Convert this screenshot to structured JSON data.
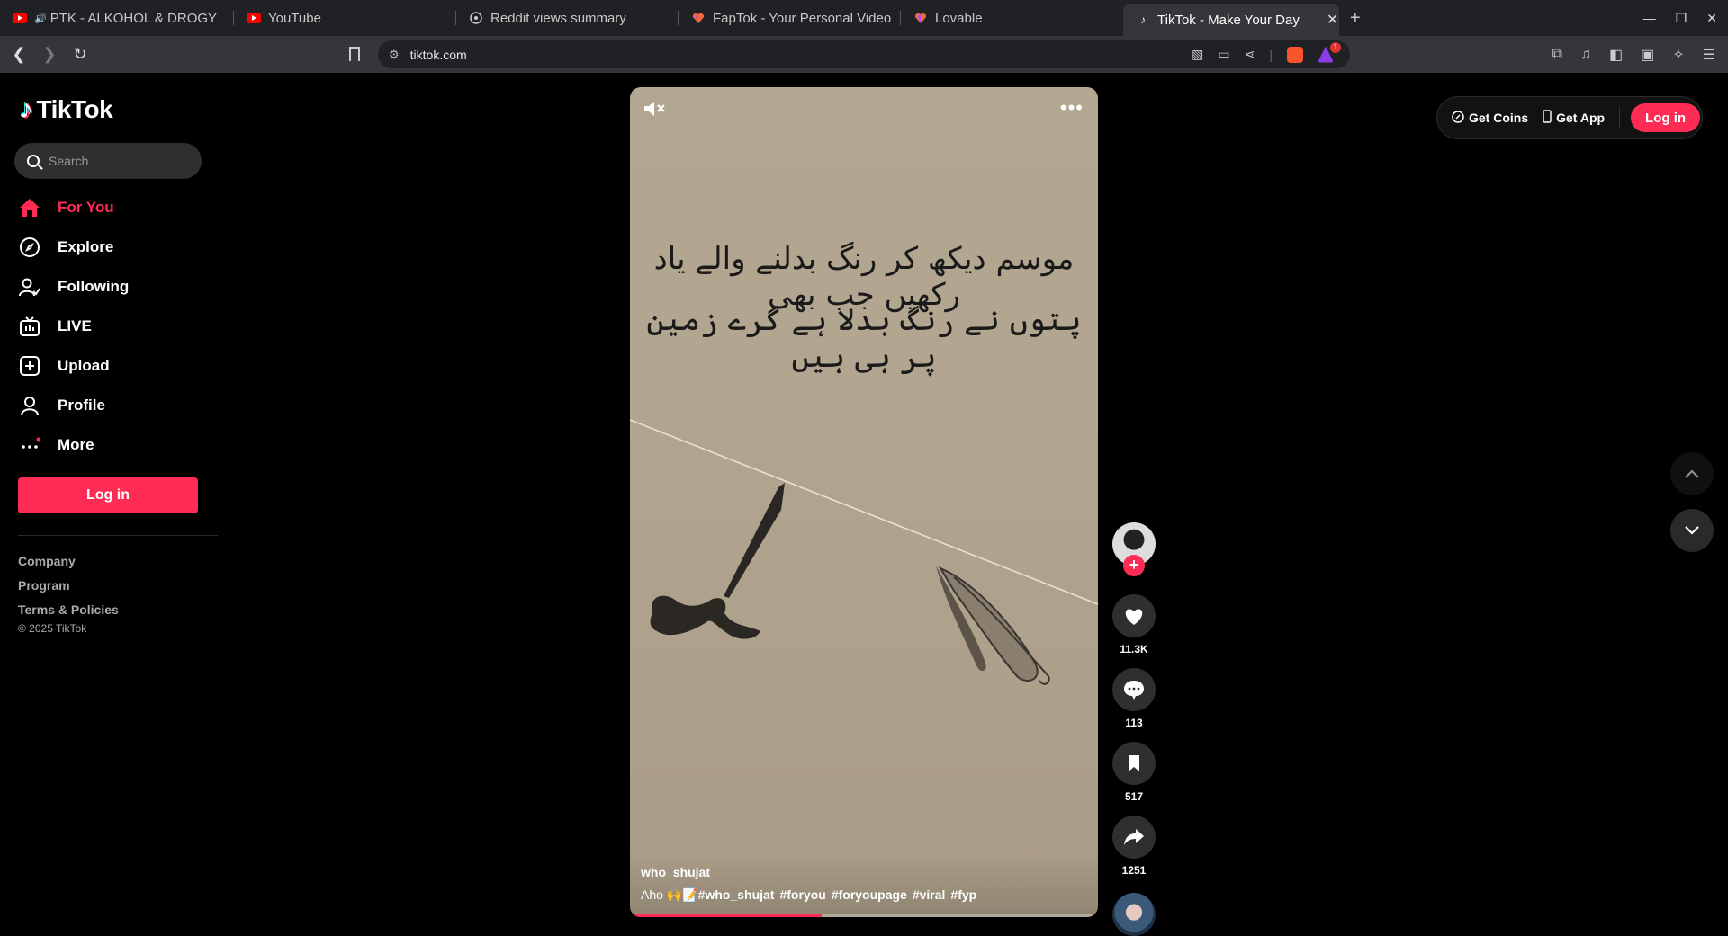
{
  "browser": {
    "tabs": [
      {
        "title": "PTK - ALKOHOL & DROGY",
        "icon": "youtube-icon",
        "active": false
      },
      {
        "title": "YouTube",
        "icon": "youtube-icon",
        "active": false
      },
      {
        "title": "Reddit views summary",
        "icon": "openai-icon",
        "active": false
      },
      {
        "title": "FapTok - Your Personal Video",
        "icon": "lovable-icon",
        "active": false
      },
      {
        "title": "Lovable",
        "icon": "lovable-icon",
        "active": false
      },
      {
        "title": "TikTok - Make Your Day",
        "icon": "tiktok-icon",
        "active": true
      }
    ],
    "url": "tiktok.com",
    "brave_badge": "1"
  },
  "sidebar": {
    "logo_text": "TikTok",
    "search_placeholder": "Search",
    "nav": [
      {
        "label": "For You",
        "icon": "home-icon",
        "active": true
      },
      {
        "label": "Explore",
        "icon": "compass-icon",
        "active": false
      },
      {
        "label": "Following",
        "icon": "following-icon",
        "active": false
      },
      {
        "label": "LIVE",
        "icon": "live-icon",
        "active": false
      },
      {
        "label": "Upload",
        "icon": "upload-icon",
        "active": false
      },
      {
        "label": "Profile",
        "icon": "profile-icon",
        "active": false
      },
      {
        "label": "More",
        "icon": "more-icon",
        "active": false
      }
    ],
    "login_label": "Log in",
    "footer": [
      "Company",
      "Program",
      "Terms & Policies"
    ],
    "copyright": "© 2025 TikTok"
  },
  "video": {
    "urdu_line1": "موسم دیکھ کر رنگ بدلنے والے یاد رکھیں جب بھی",
    "urdu_line2": "پتوں نے رنگ بدلا ہے گرے زمین پر ہی ہیں",
    "author": "who_shujat",
    "desc_prefix": "Aho 🙌📝",
    "hashtags": [
      "#who_shujat",
      "#foryou",
      "#foryoupage",
      "#viral",
      "#fyp"
    ],
    "progress": 0.41
  },
  "actions": {
    "likes": "11.3K",
    "comments": "113",
    "saves": "517",
    "shares": "1251"
  },
  "topright": {
    "coins_label": "Get Coins",
    "app_label": "Get App",
    "login_label": "Log in"
  },
  "colors": {
    "accent": "#fe2c55",
    "background": "#000000",
    "video_bg": "#b1a58f"
  }
}
